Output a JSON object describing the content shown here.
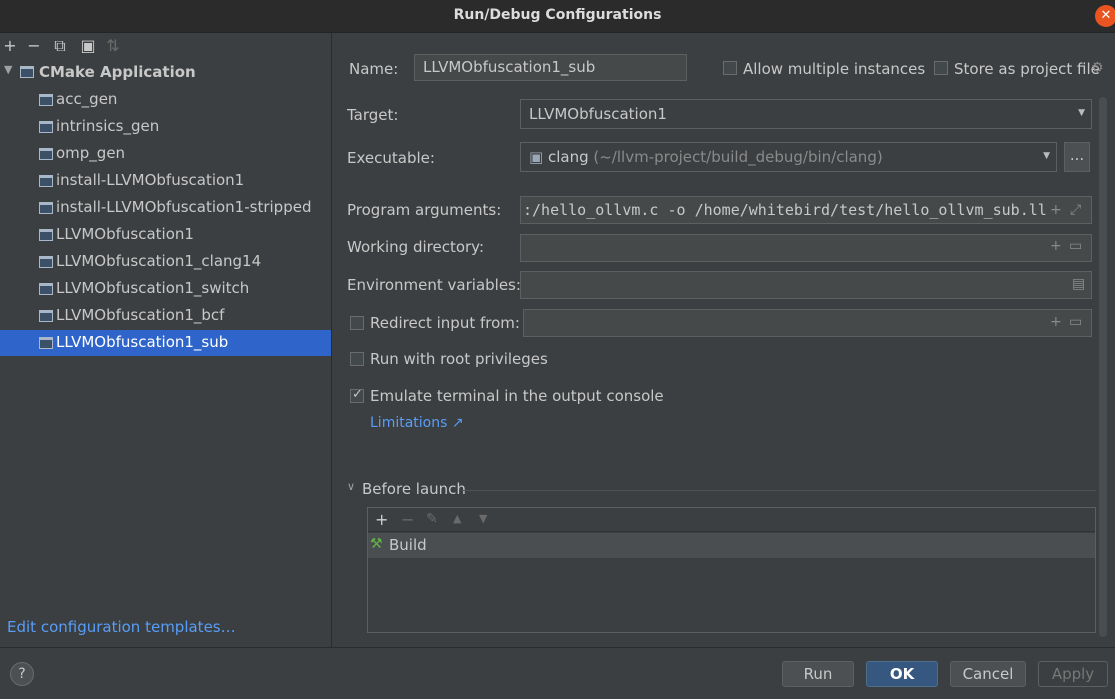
{
  "window": {
    "title": "Run/Debug Configurations"
  },
  "toolbar": {
    "add_icon": "+",
    "remove_icon": "−",
    "copy_icon": "⧉",
    "folder_icon": "▣",
    "sort_icon": "⇅"
  },
  "tree": {
    "root_label": "CMake Application",
    "items": [
      {
        "label": "acc_gen"
      },
      {
        "label": "intrinsics_gen"
      },
      {
        "label": "omp_gen"
      },
      {
        "label": "install-LLVMObfuscation1"
      },
      {
        "label": "install-LLVMObfuscation1-stripped"
      },
      {
        "label": "LLVMObfuscation1"
      },
      {
        "label": "LLVMObfuscation1_clang14"
      },
      {
        "label": "LLVMObfuscation1_switch"
      },
      {
        "label": "LLVMObfuscation1_bcf"
      },
      {
        "label": "LLVMObfuscation1_sub"
      }
    ],
    "selected": "LLVMObfuscation1_sub"
  },
  "edit_templates_link": "Edit configuration templates…",
  "form": {
    "name_label": "Name:",
    "name_value": "LLVMObfuscation1_sub",
    "allow_multiple_label": "Allow multiple instances",
    "store_as_project_label": "Store as project file",
    "target_label": "Target:",
    "target_value": "LLVMObfuscation1",
    "executable_label": "Executable:",
    "executable_value": "clang",
    "executable_path": "(~/llvm-project/build_debug/bin/clang)",
    "ellipsis": "...",
    "program_args_label": "Program arguments:",
    "program_args_value": ":/hello_ollvm.c -o /home/whitebird/test/hello_ollvm_sub.ll",
    "working_dir_label": "Working directory:",
    "working_dir_value": "",
    "env_vars_label": "Environment variables:",
    "env_vars_value": "",
    "redirect_label": "Redirect input from:",
    "redirect_value": "",
    "root_priv_label": "Run with root privileges",
    "emulate_label": "Emulate terminal in the output console",
    "limitations_link": "Limitations ↗"
  },
  "before_launch": {
    "title": "Before launch",
    "tasks": [
      {
        "label": "Build"
      }
    ]
  },
  "buttons": {
    "help": "?",
    "run": "Run",
    "ok": "OK",
    "cancel": "Cancel",
    "apply": "Apply"
  },
  "colors": {
    "background": "#3c3f41",
    "selection": "#2f65ca",
    "link": "#589df6",
    "primary_button": "#365880"
  }
}
